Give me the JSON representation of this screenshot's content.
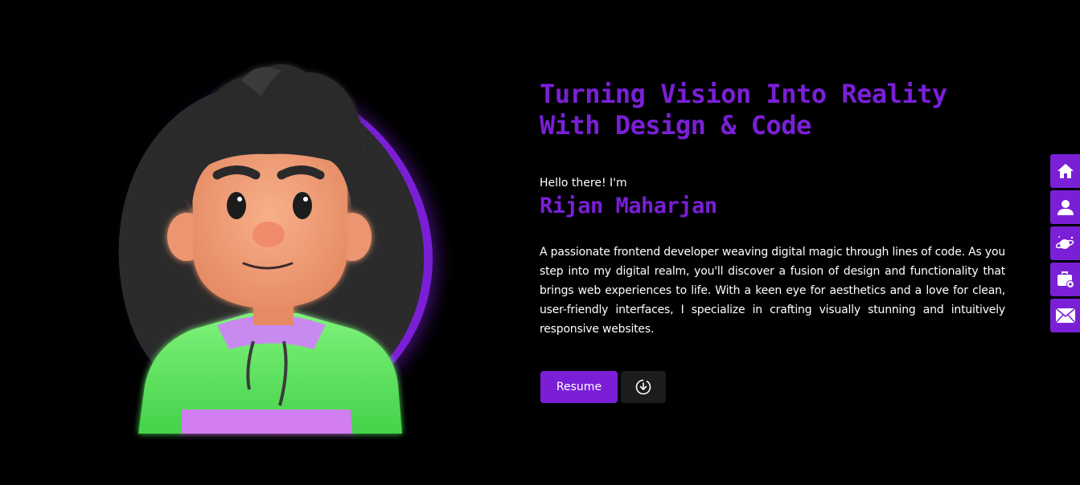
{
  "hero": {
    "headline": "Turning Vision Into Reality With Design & Code",
    "greeting": "Hello there! I'm",
    "name": "Rijan Maharjan",
    "bio": "A passionate frontend developer weaving digital magic through lines of code. As you step into my digital realm, you'll discover a fusion of design and functionality that brings web experiences to life. With a keen eye for aesthetics and a love for clean, user-friendly interfaces, I specialize in crafting visually stunning and intuitively responsive websites.",
    "resume_label": "Resume",
    "download_icon": "download-circle-icon"
  },
  "side_nav": {
    "items": [
      {
        "icon": "home-icon"
      },
      {
        "icon": "user-icon"
      },
      {
        "icon": "planet-icon"
      },
      {
        "icon": "briefcase-icon"
      },
      {
        "icon": "mail-icon"
      }
    ]
  },
  "colors": {
    "background": "#000000",
    "accent": "#7a1fd6",
    "text": "#ffffff",
    "secondary_button": "#1c1c1c",
    "avatar_blob": "#2b2b2b"
  }
}
